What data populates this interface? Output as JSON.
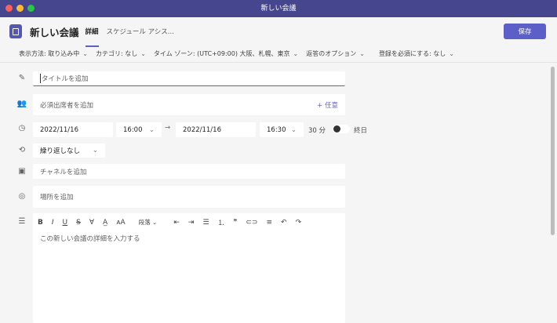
{
  "window": {
    "title": "新しい会議"
  },
  "header": {
    "title": "新しい会議",
    "tabs": [
      "詳細",
      "スケジュール アシス..."
    ],
    "save_label": "保存"
  },
  "options": [
    "表示方法: 取り込み中",
    "カテゴリ: なし",
    "タイム ゾーン: (UTC+09:00) 大阪、札幌、東京",
    "返答のオプション",
    "登録を必須にする: なし"
  ],
  "form": {
    "title_placeholder": "タイトルを追加",
    "attendees_placeholder": "必須出席者を追加",
    "optional_label": "+ 任意",
    "start_date": "2022/11/16",
    "start_time": "16:00",
    "end_date": "2022/11/16",
    "end_time": "16:30",
    "duration": "30 分",
    "all_day_label": "終日",
    "repeat": "繰り返しなし",
    "channel_placeholder": "チャネルを追加",
    "location_placeholder": "場所を追加",
    "paragraph_label": "段落",
    "details_placeholder": "この新しい会議の詳細を入力する"
  }
}
